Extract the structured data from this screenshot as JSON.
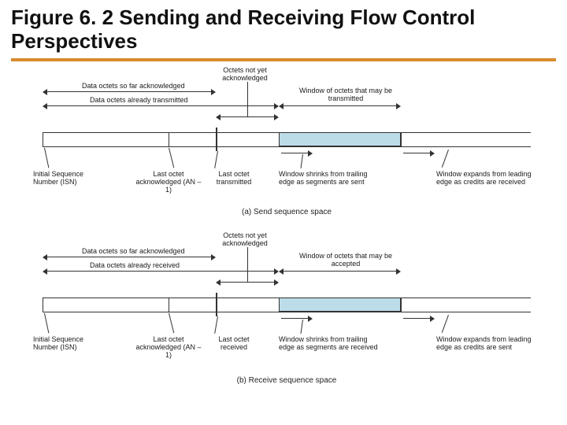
{
  "title": "Figure 6. 2 Sending and Receiving Flow Control Perspectives",
  "top": {
    "ack_so_far": "Data octets so far acknowledged",
    "already_tx": "Data octets already transmitted",
    "not_yet_ack": "Octets not yet acknowledged",
    "window_tx": "Window of octets that may be transmitted",
    "isn": "Initial Sequence Number (ISN)",
    "last_ack": "Last octet acknowledged (AN – 1)",
    "last_tx": "Last octet transmitted",
    "shrink": "Window shrinks from trailing edge as segments are sent",
    "expand": "Window expands from leading edge as credits are received",
    "caption": "(a) Send sequence space"
  },
  "bot": {
    "ack_so_far": "Data octets so far acknowledged",
    "already_rx": "Data octets already received",
    "not_yet_ack": "Octets not yet acknowledged",
    "window_rx": "Window of octets that may be accepted",
    "isn": "Initial Sequence Number (ISN)",
    "last_ack": "Last octet acknowledged (AN – 1)",
    "last_rx": "Last octet received",
    "shrink": "Window shrinks from trailing edge as segments are received",
    "expand": "Window expands from leading edge as credits are sent",
    "caption": "(b) Receive sequence space"
  }
}
